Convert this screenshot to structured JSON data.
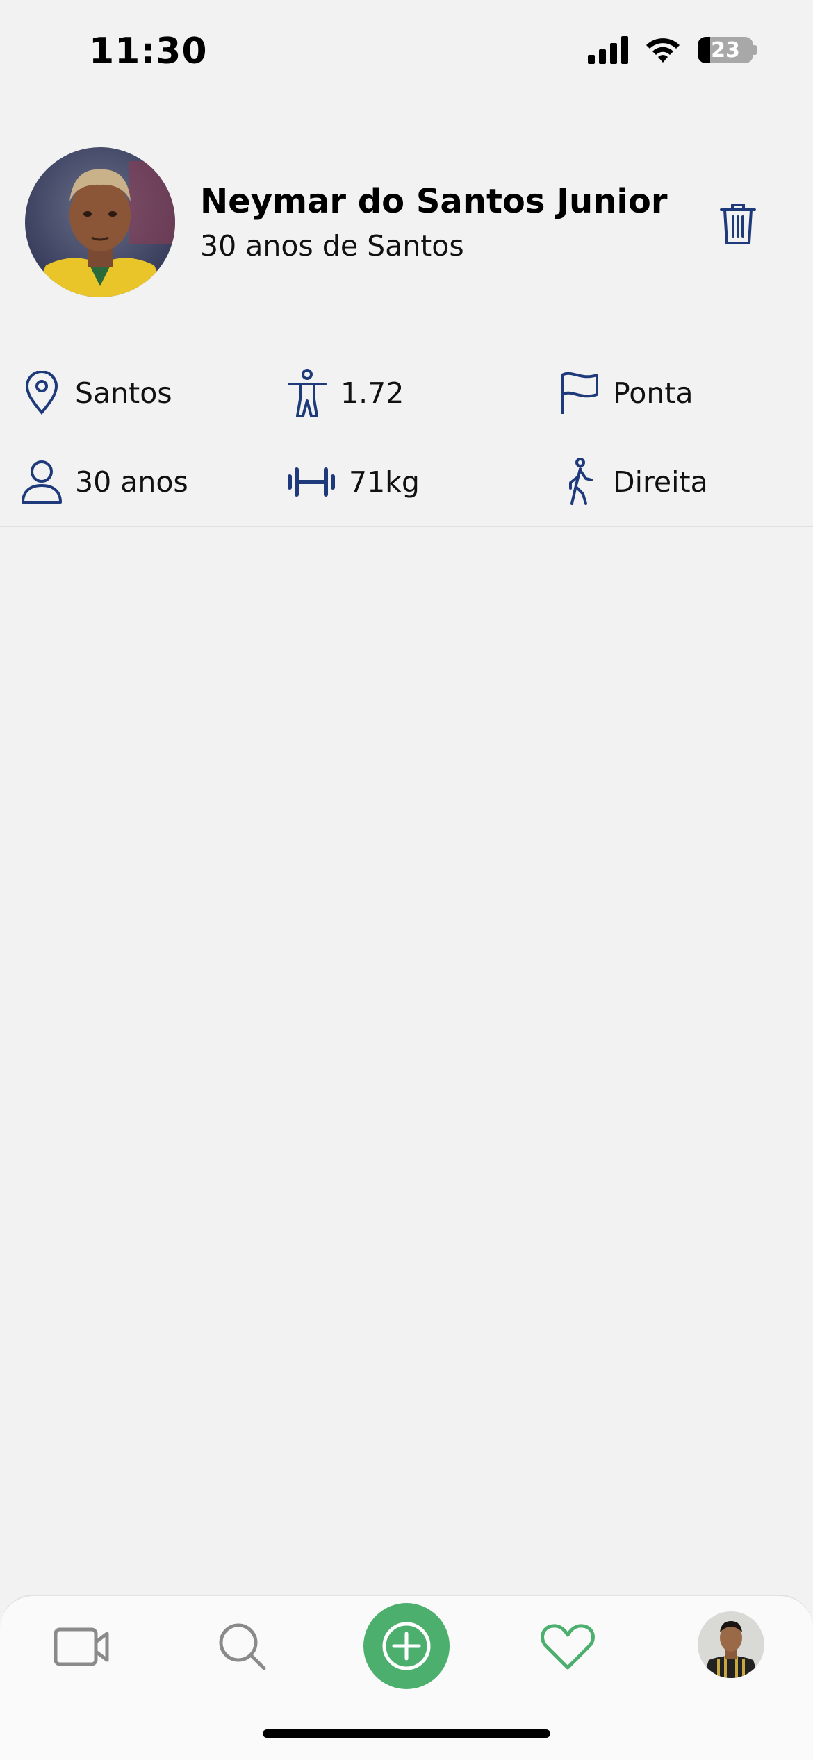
{
  "status_bar": {
    "time": "11:30",
    "battery": "23"
  },
  "profile": {
    "name": "Neymar do Santos Junior",
    "subtitle": "30 anos de Santos"
  },
  "stats": {
    "location": "Santos",
    "height": "1.72",
    "position": "Ponta",
    "age": "30 anos",
    "weight": "71kg",
    "foot": "Direita"
  },
  "tabbar": {
    "items": [
      "video-icon",
      "search-icon",
      "add-circle-icon",
      "heart-icon",
      "profile-avatar"
    ]
  },
  "colors": {
    "accent": "#1f3a7a",
    "green": "#4caf6e",
    "background": "#f2f2f3"
  }
}
